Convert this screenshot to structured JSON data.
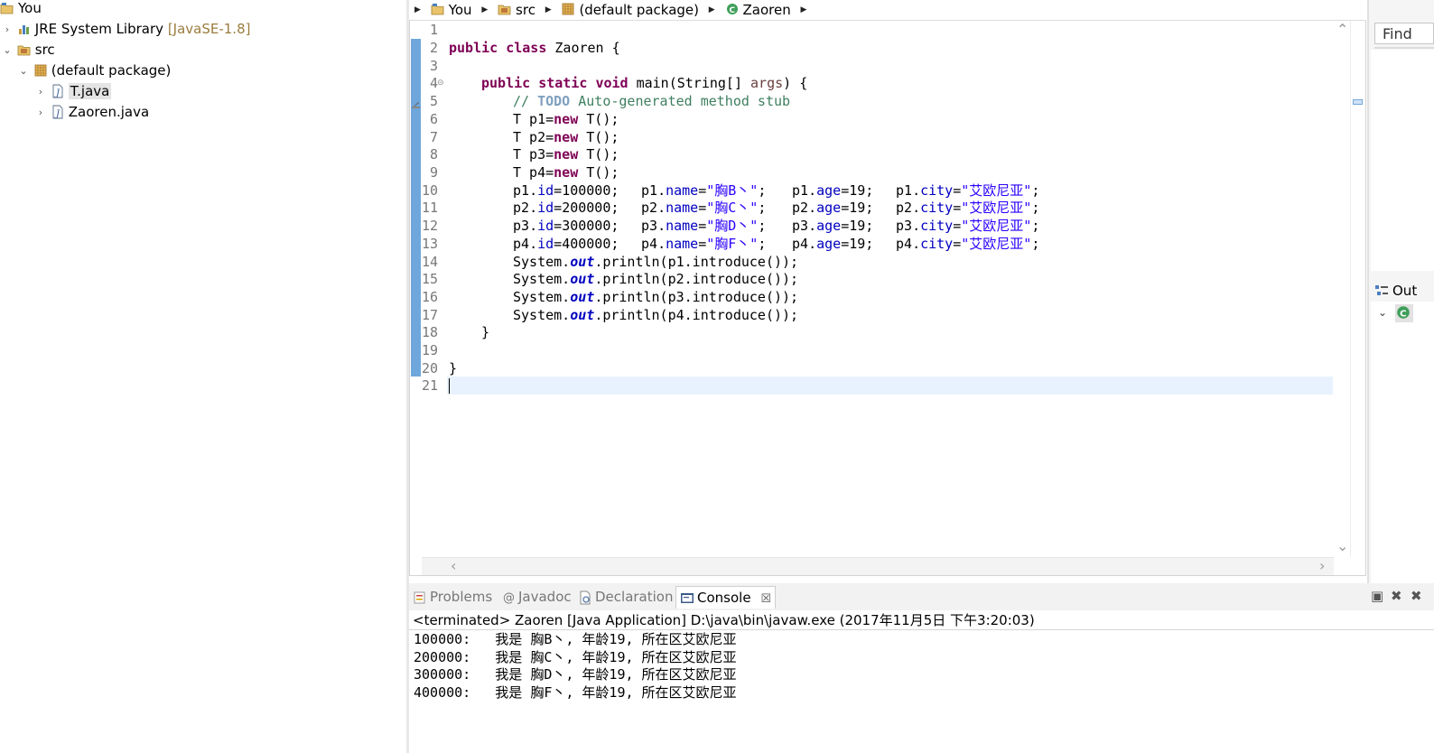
{
  "explorer": {
    "items": [
      {
        "label": "You",
        "deco": ""
      },
      {
        "label": "JRE System Library",
        "deco": "[JavaSE-1.8]"
      },
      {
        "label": "src",
        "deco": ""
      },
      {
        "label": "(default package)",
        "deco": ""
      },
      {
        "label": "T.java",
        "deco": ""
      },
      {
        "label": "Zaoren.java",
        "deco": ""
      }
    ]
  },
  "breadcrumb": [
    "You",
    "src",
    "(default package)",
    "Zaoren"
  ],
  "editor": {
    "line_numbers": [
      "1",
      "2",
      "3",
      "4",
      "5",
      "6",
      "7",
      "8",
      "9",
      "10",
      "11",
      "12",
      "13",
      "14",
      "15",
      "16",
      "17",
      "18",
      "19",
      "20",
      "21"
    ],
    "tokens": {
      "public": "public",
      "class": "class",
      "static": "static",
      "void": "void",
      "new": "new",
      "class_name": " Zaoren {",
      "main_sig": " main(String[] ",
      "args": "args",
      "main_end": ") {",
      "comment_start": "// ",
      "todo": "TODO",
      "comment_rest": " Auto-generated method stub",
      "decl_p1": "T p1=",
      "decl_p2": "T p2=",
      "decl_p3": "T p3=",
      "decl_p4": "T p4=",
      "ctor": " T();",
      "p1": "p1",
      "p2": "p2",
      "p3": "p3",
      "p4": "p4",
      "id": "id",
      "name": "name",
      "age": "age",
      "city": "city",
      "dot": ".",
      "eq": "=",
      "id1": "100000;",
      "id2": "200000;",
      "id3": "300000;",
      "id4": "400000;",
      "name1": "\"胸B丶\"",
      "name2": "\"胸C丶\"",
      "name3": "\"胸D丶\"",
      "name4": "\"胸F丶\"",
      "semi": ";",
      "age_val": "19;",
      "city_val": "\"艾欧尼亚\"",
      "sys": "System.",
      "out": "out",
      "println": ".println(",
      "introduce": ".introduce());",
      "close_brace": "}",
      "gap": "   "
    }
  },
  "right": {
    "find_label": "Find",
    "outline_label": "Out"
  },
  "console": {
    "tabs": [
      "Problems",
      "Javadoc",
      "Declaration",
      "Console"
    ],
    "header": "<terminated> Zaoren [Java Application] D:\\java\\bin\\javaw.exe (2017年11月5日 下午3:20:03)",
    "lines": [
      "100000:   我是 胸B丶, 年龄19, 所在区艾欧尼亚",
      "200000:   我是 胸C丶, 年龄19, 所在区艾欧尼亚",
      "300000:   我是 胸D丶, 年龄19, 所在区艾欧尼亚",
      "400000:   我是 胸F丶, 年龄19, 所在区艾欧尼亚"
    ]
  },
  "colors": {
    "keyword": "#7f0055",
    "field": "#0000c0",
    "string": "#2a00ff",
    "comment": "#3f7f5f",
    "todo": "#7f9fbf",
    "quickdiff": "#6fa7dc",
    "current_line": "#e8f2fe"
  },
  "icons": {
    "project": "project-folder-icon",
    "library": "library-icon",
    "source_folder": "source-folder-icon",
    "package": "package-icon",
    "java_file": "java-file-icon",
    "class": "class-icon"
  }
}
